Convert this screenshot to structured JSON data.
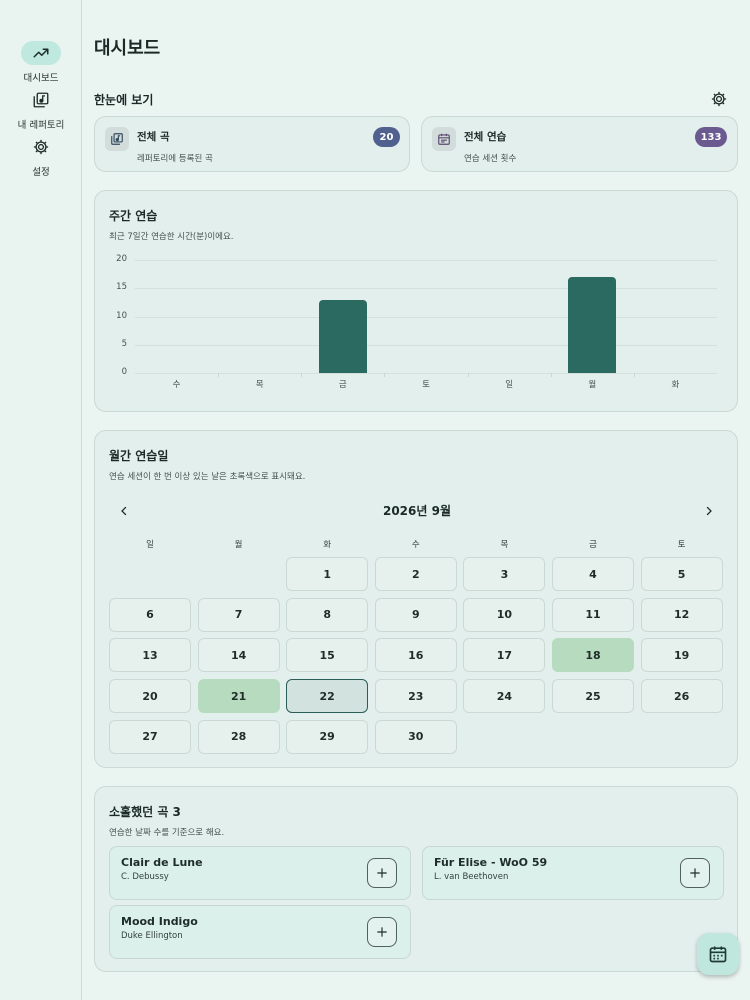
{
  "nav": {
    "items": [
      {
        "label": "대시보드",
        "icon": "trending-icon",
        "active": true
      },
      {
        "label": "내 레퍼토리",
        "icon": "library-music-icon",
        "active": false
      },
      {
        "label": "설정",
        "icon": "gear-icon",
        "active": false
      }
    ]
  },
  "header": {
    "title": "대시보드"
  },
  "overview": {
    "title": "한눈에 보기",
    "settings_icon": "gear-icon",
    "total_songs": {
      "title": "전체 곡",
      "subtitle": "레퍼토리에 등록된 곡",
      "count": "20",
      "badge_color": "#51618f"
    },
    "total_sessions": {
      "title": "전체 연습",
      "subtitle": "연습 세션 횟수",
      "count": "133",
      "badge_color": "#6a5a8f"
    }
  },
  "weekly": {
    "title": "주간 연습",
    "subtitle": "최근 7일간 연습한 시간(분)이에요.",
    "chart_data": {
      "type": "bar",
      "categories": [
        "수",
        "목",
        "금",
        "토",
        "일",
        "월",
        "화"
      ],
      "values": [
        0,
        0,
        13,
        0,
        0,
        17,
        0
      ],
      "ylim": [
        0,
        20
      ],
      "yticks": [
        "20",
        "15",
        "10",
        "5",
        "0"
      ],
      "color": "#2a6a60",
      "grid": true
    }
  },
  "monthly": {
    "title": "월간 연습일",
    "subtitle": "연습 세션이 한 번 이상 있는 날은 초록색으로 표시돼요.",
    "month_label": "2026년 9월",
    "weekdays": [
      "일",
      "월",
      "화",
      "수",
      "목",
      "금",
      "토"
    ],
    "first_weekday_index": 2,
    "days": [
      "1",
      "2",
      "3",
      "4",
      "5",
      "6",
      "7",
      "8",
      "9",
      "10",
      "11",
      "12",
      "13",
      "14",
      "15",
      "16",
      "17",
      "18",
      "19",
      "20",
      "21",
      "22",
      "23",
      "24",
      "25",
      "26",
      "27",
      "28",
      "29",
      "30"
    ],
    "practiced_days": [
      18,
      21
    ],
    "today": 22,
    "practiced_color": "#b7dbbe"
  },
  "neglected": {
    "title": "소홀했던 곡 3",
    "subtitle": "연습한 날짜 수를 기준으로 해요.",
    "songs": [
      {
        "title": "Clair de Lune",
        "artist": "C. Debussy"
      },
      {
        "title": "Für Elise - WoO 59",
        "artist": "L. van Beethoven"
      },
      {
        "title": "Mood Indigo",
        "artist": "Duke Ellington"
      }
    ]
  },
  "fab": {
    "icon": "calendar-icon"
  }
}
